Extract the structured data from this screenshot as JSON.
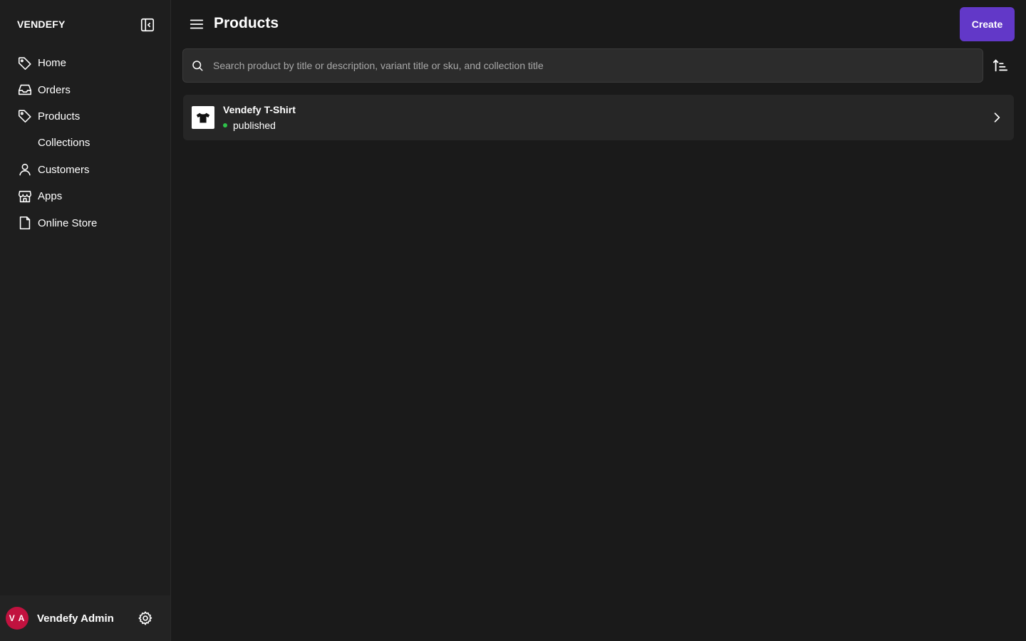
{
  "brand": "VENDEFY",
  "sidebar": {
    "items": [
      {
        "label": "Home",
        "icon": "tag-icon"
      },
      {
        "label": "Orders",
        "icon": "inbox-icon"
      },
      {
        "label": "Products",
        "icon": "tag-icon"
      },
      {
        "label": "Collections",
        "icon": ""
      },
      {
        "label": "Customers",
        "icon": "user-icon"
      },
      {
        "label": "Apps",
        "icon": "store-icon"
      },
      {
        "label": "Online Store",
        "icon": "file-icon"
      }
    ],
    "user": {
      "initials": "V A",
      "name": "Vendefy Admin"
    }
  },
  "header": {
    "title": "Products",
    "create_label": "Create"
  },
  "search": {
    "placeholder": "Search product by title or description, variant title or sku, and collection title",
    "value": ""
  },
  "products": [
    {
      "title": "Vendefy T-Shirt",
      "status": "published"
    }
  ],
  "colors": {
    "accent": "#6238c8",
    "status_published": "#2ec24a",
    "avatar": "#c1123f"
  }
}
